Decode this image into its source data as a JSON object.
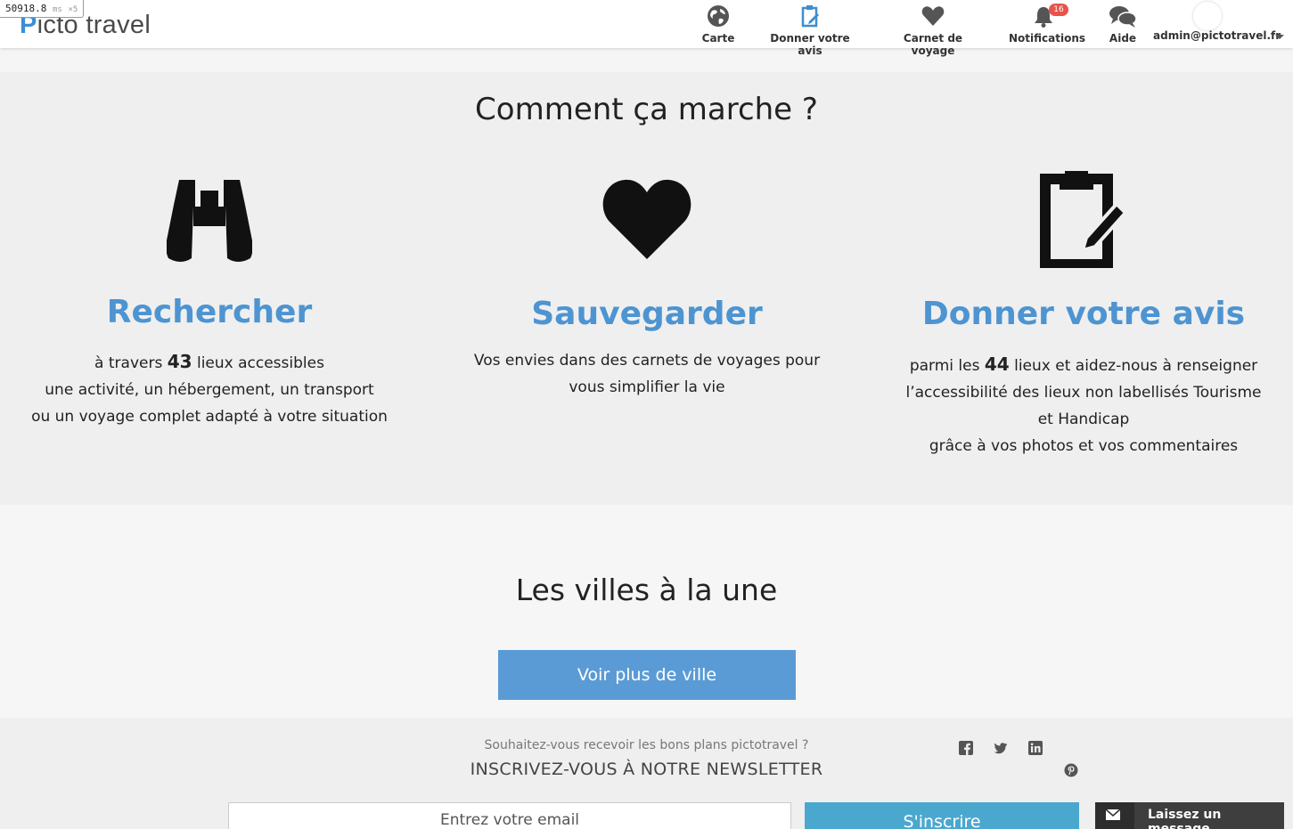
{
  "debug": {
    "time": "50918.8",
    "unit": "ms",
    "mult": "×5"
  },
  "header": {
    "logo_initial": "P",
    "logo_text": "icto travel",
    "nav": {
      "carte": "Carte",
      "donner_avis": "Donner votre avis",
      "carnet": "Carnet de voyage",
      "notifications": "Notifications",
      "notifications_count": "16",
      "aide": "Aide"
    },
    "user_email": "admin@pictotravel.fr"
  },
  "how": {
    "title": "Comment ça marche ?",
    "search": {
      "icon": "binoculars-icon",
      "title": "Rechercher",
      "line1_pre": "à travers ",
      "count": "43",
      "line1_post": " lieux accessibles",
      "line2": "une activité, un hébergement, un transport",
      "line3": "ou un voyage complet adapté à votre situation"
    },
    "save": {
      "icon": "heart-icon",
      "title": "Sauvegarder",
      "line1": "Vos envies dans des carnets de voyages pour",
      "line2": "vous simplifier la vie"
    },
    "review": {
      "icon": "clipboard-edit-icon",
      "title": "Donner votre avis",
      "line1_pre": "parmi les ",
      "count": "44",
      "line1_post": " lieux et aidez-nous à renseigner",
      "line2": "l’accessibilité des lieux non labellisés Tourisme",
      "line3": "et Handicap",
      "line4": "grâce à vos photos et vos commentaires"
    }
  },
  "cities": {
    "title": "Les villes à la une",
    "more_button": "Voir plus de ville"
  },
  "newsletter": {
    "question": "Souhaitez-vous recevoir les bons plans pictotravel ?",
    "cta": "INSCRIVEZ-VOUS À NOTRE NEWSLETTER",
    "email_placeholder": "Entrez votre email",
    "subscribe": "S'inscrire"
  },
  "chat": {
    "label": "Laissez un message"
  },
  "colors": {
    "accent": "#4d94d1",
    "button": "#5b9bd5",
    "subscribe": "#4aa8cf",
    "badge": "#e8534b"
  }
}
